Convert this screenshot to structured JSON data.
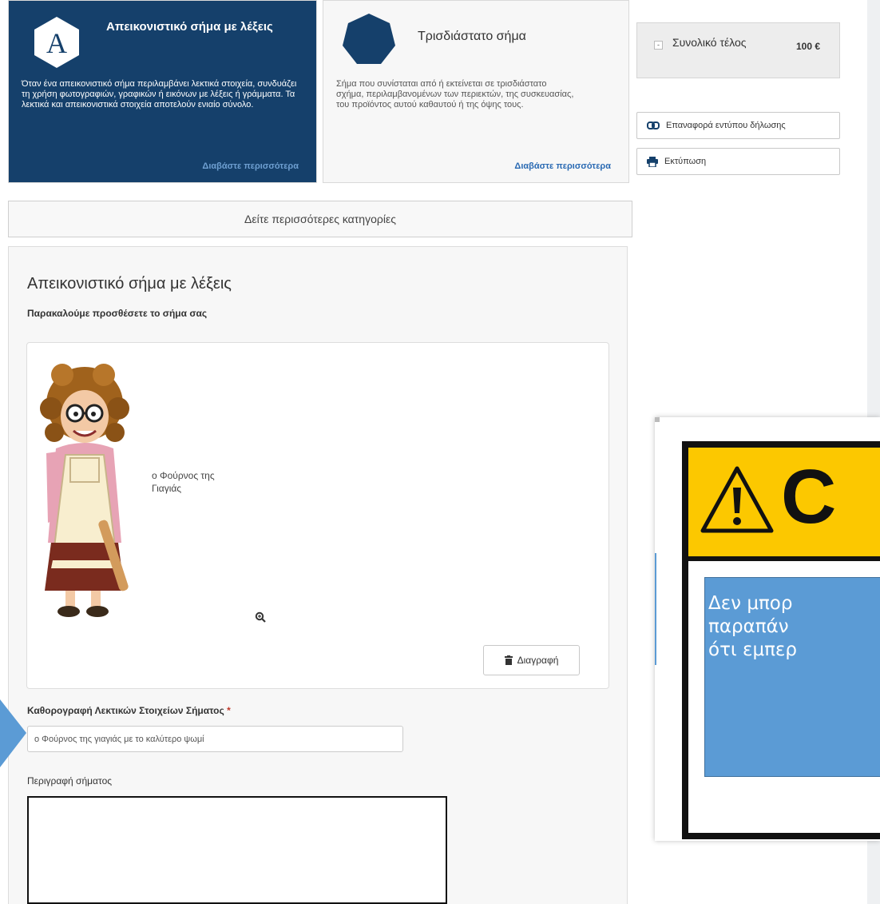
{
  "categories": [
    {
      "title": "Απεικονιστικό σήμα με λέξεις",
      "icon_letter": "A",
      "description": "Όταν ένα απεικονιστικό σήμα περιλαμβάνει λεκτικά στοιχεία, συνδυάζει τη χρήση φωτογραφιών, γραφικών ή εικόνων με λέξεις ή γράμματα. Τα λεκτικά και απεικονιστικά στοιχεία αποτελούν ενιαίο σύνολο.",
      "link": "Διαβάστε περισσότερα"
    },
    {
      "title": "Τρισδιάστατο σήμα",
      "description": "Σήμα που συνίσταται από ή εκτείνεται σε τρισδιάστατο σχήμα, περιλαμβανομένων των περιεκτών, της συσκευασίας, του προϊόντος αυτού καθαυτού ή της όψης τους.",
      "link": "Διαβάστε περισσότερα"
    }
  ],
  "more_categories": "Δείτε περισσότερες κατηγορίες",
  "form": {
    "title": "Απεικονιστικό σήμα με λέξεις",
    "subtitle": "Παρακαλούμε προσθέσετε το σήμα σας",
    "image_caption_line1": "ο Φούρνος της",
    "image_caption_line2": "Γιαγιάς",
    "delete_label": "Διαγραφή",
    "verbal_label": "Καθορογραφή Λεκτικών Στοιχείων Σήματος",
    "required_mark": "*",
    "verbal_value": "ο Φούρνος της γιαγιάς με το καλύτερο ψωμί",
    "description_label": "Περιγραφή σήματος"
  },
  "fee": {
    "toggle": "-",
    "label": "Συνολικό τέλος",
    "amount": "100 €"
  },
  "actions": {
    "restore": "Επαναφορά εντύπου δήλωσης",
    "print": "Εκτύπωση"
  },
  "warning": {
    "word": "C",
    "line1": "Δεν μπορ",
    "line2": "παραπάν",
    "line3": "ότι εμπερ"
  },
  "colors": {
    "card_dark": "#15406b",
    "warning_yellow": "#fcc800",
    "callout_blue": "#5b9bd5"
  }
}
